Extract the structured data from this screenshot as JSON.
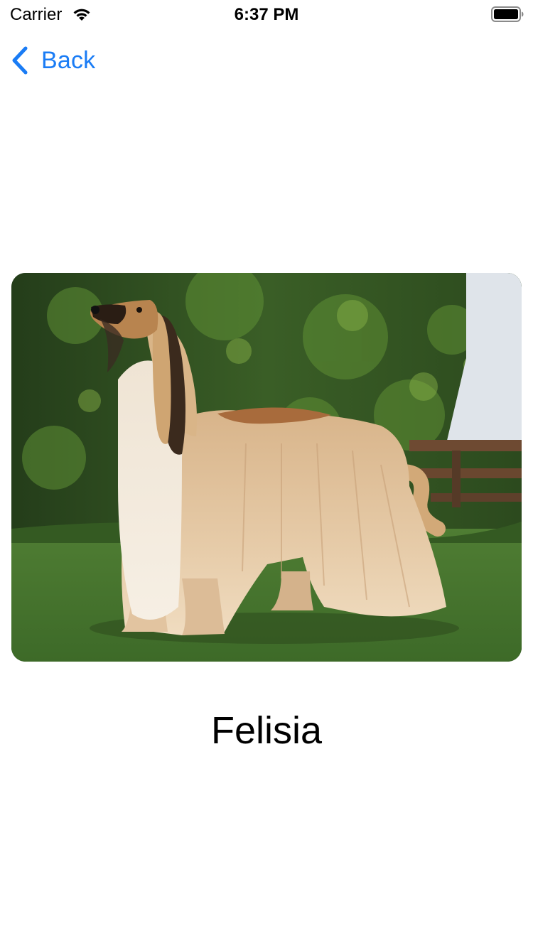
{
  "status_bar": {
    "carrier": "Carrier",
    "time": "6:37 PM",
    "icons": [
      "wifi-icon",
      "battery-icon"
    ]
  },
  "nav": {
    "back_label": "Back",
    "back_icon": "chevron-left-icon",
    "accent_color": "#1a7cf5"
  },
  "detail": {
    "photo_subject": "dog-photo",
    "name": "Felisia"
  }
}
